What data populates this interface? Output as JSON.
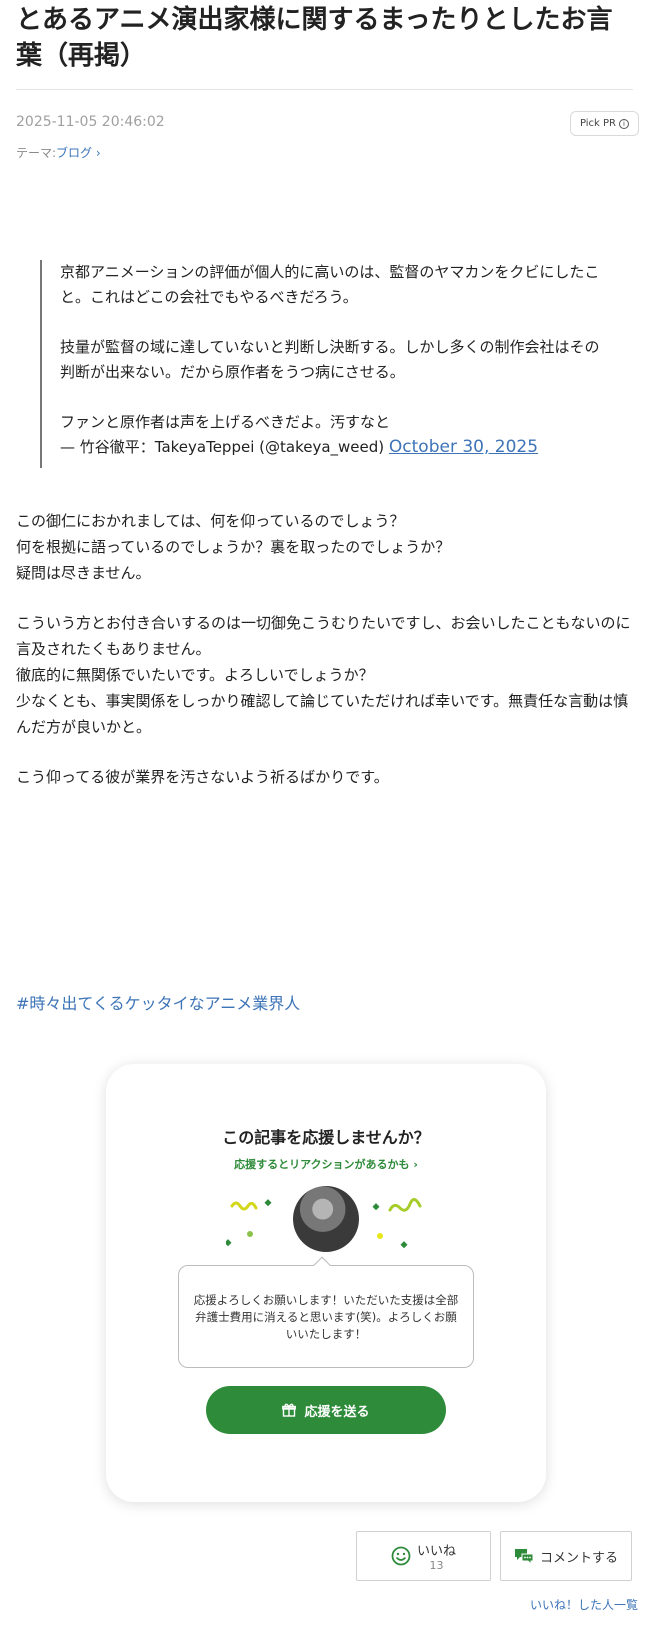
{
  "article": {
    "title": "とあるアニメ演出家様に関するまったりとしたお言葉（再掲）",
    "date": "2025-11-05 20:46:02",
    "pick_pr": "Pick PR",
    "theme_label": "テーマ:",
    "theme_link": "ブログ ›"
  },
  "quote": {
    "lines": [
      "京都アニメーションの評価が個人的に高いのは、監督のヤマカンをクビにしたこと。これはどこの会社でもやるべきだろう。",
      "技量が監督の域に達していないと判断し決断する。しかし多くの制作会社はその判断が出来ない。だから原作者をうつ病にさせる。",
      "ファンと原作者は声を上げるべきだよ。汚すなと"
    ],
    "attribution": "— 竹谷徹平：TakeyaTeppei (@takeya_weed)",
    "date_link": "October 30, 2025"
  },
  "body": {
    "p1": [
      "この御仁におかれましては、何を仰っているのでしょう？",
      "何を根拠に語っているのでしょうか？裏を取ったのでしょうか？",
      "疑問は尽きません。"
    ],
    "p2": [
      "こういう方とお付き合いするのは一切御免こうむりたいですし、お会いしたこともないのに言及されたくもありません。",
      "徹底的に無関係でいたいです。よろしいでしょうか？",
      "少なくとも、事実関係をしっかり確認して論じていただければ幸いです。無責任な言動は慎んだ方が良いかと。"
    ],
    "p3": [
      "こう仰ってる彼が業界を汚さないよう祈るばかりです。"
    ]
  },
  "hashtag": "#時々出てくるケッタイなアニメ業界人",
  "support": {
    "title": "この記事を応援しませんか？",
    "subtitle": "応援するとリアクションがあるかも ›",
    "message": "応援よろしくお願いします！いただいた支援は全部弁護士費用に消えると思います(笑)。よろしくお願いいたします！",
    "button": "応援を送る",
    "accent": "#2e8b3a"
  },
  "reactions": {
    "like_label": "いいね",
    "like_count": "13",
    "comment_label": "コメントする",
    "likers_link": "いいね！した人一覧"
  }
}
